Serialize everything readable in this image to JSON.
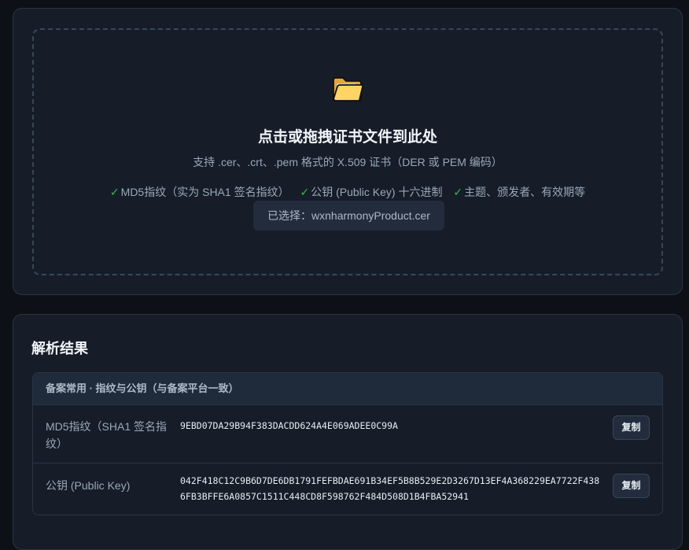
{
  "upload": {
    "icon": "folder-icon",
    "title": "点击或拖拽证书文件到此处",
    "subtitle": "支持 .cer、.crt、.pem 格式的 X.509 证书（DER 或 PEM 编码）",
    "features": [
      "MD5指纹（实为 SHA1 签名指纹）",
      "公钥 (Public Key) 十六进制",
      "主题、颁发者、有效期等"
    ],
    "check_mark": "✓",
    "selected_file": "已选择：wxnharmonyProduct.cer"
  },
  "results": {
    "title": "解析结果",
    "section_header": "备案常用 · 指纹与公钥（与备案平台一致）",
    "rows": [
      {
        "label": "MD5指纹（SHA1 签名指纹）",
        "value": "9EBD07DA29B94F383DACDD624A4E069ADEE0C99A",
        "copy_label": "复制"
      },
      {
        "label": "公钥 (Public Key)",
        "value": "042F418C12C9B6D7DE6DB1791FEFBDAE691B34EF5B8B529E2D3267D13EF4A368229EA7722F4386FB3BFFE6A0857C1511C448CD8F598762F484D508D1B4FBA52941",
        "copy_label": "复制"
      }
    ]
  },
  "colors": {
    "background": "#0d1117",
    "card": "#161d28",
    "check": "#3fb950"
  }
}
